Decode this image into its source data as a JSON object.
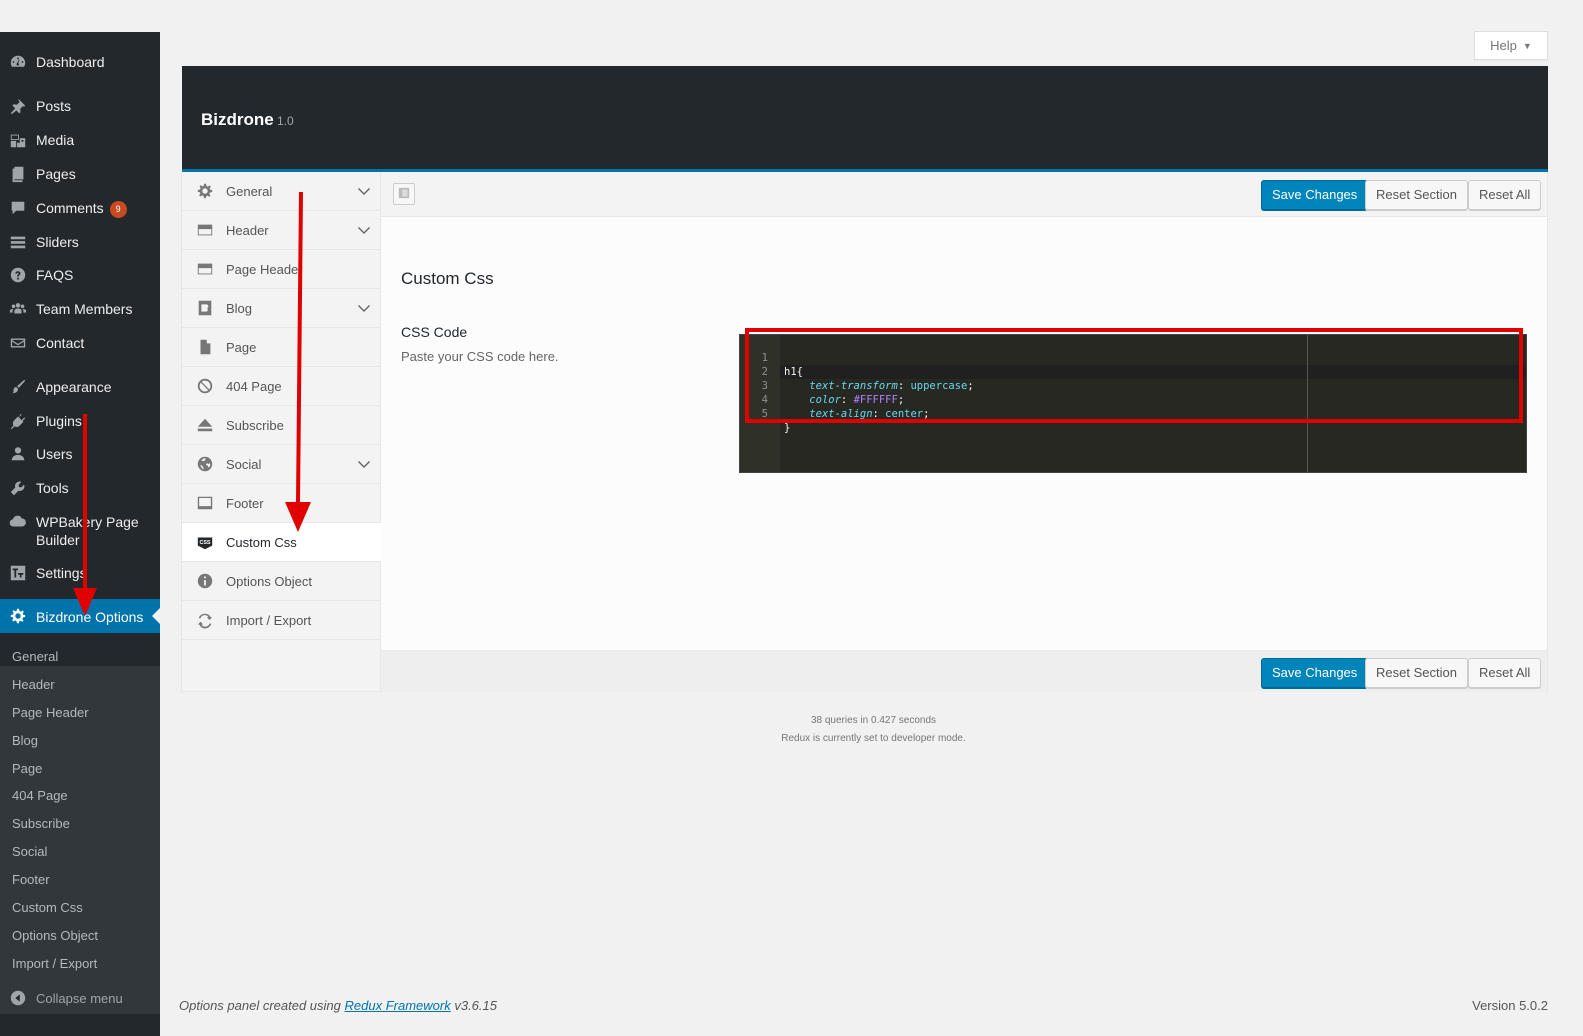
{
  "admin_menu": {
    "items": [
      {
        "label": "Dashboard",
        "icon": "dashboard-icon"
      },
      {
        "label": "Posts",
        "icon": "pushpin-icon"
      },
      {
        "label": "Media",
        "icon": "media-icon"
      },
      {
        "label": "Pages",
        "icon": "pages-icon"
      },
      {
        "label": "Comments",
        "icon": "comment-icon",
        "badge": "9"
      },
      {
        "label": "Sliders",
        "icon": "sliders-icon"
      },
      {
        "label": "FAQS",
        "icon": "question-icon"
      },
      {
        "label": "Team Members",
        "icon": "groups-icon"
      },
      {
        "label": "Contact",
        "icon": "email-icon"
      },
      {
        "label": "Appearance",
        "icon": "paintbrush-icon"
      },
      {
        "label": "Plugins",
        "icon": "plugin-icon"
      },
      {
        "label": "Users",
        "icon": "user-icon"
      },
      {
        "label": "Tools",
        "icon": "wrench-icon"
      },
      {
        "label": "WPBakery Page Builder",
        "icon": "cloud-icon"
      },
      {
        "label": "Settings",
        "icon": "settings-icon"
      },
      {
        "label": "Bizdrone Options",
        "icon": "gear-icon",
        "current": true
      }
    ],
    "submenu": [
      "General",
      "Header",
      "Page Header",
      "Blog",
      "Page",
      "404 Page",
      "Subscribe",
      "Social",
      "Footer",
      "Custom Css",
      "Options Object",
      "Import / Export"
    ],
    "collapse_label": "Collapse menu"
  },
  "help_tab": {
    "label": "Help"
  },
  "redux": {
    "title": "Bizdrone",
    "version": "1.0",
    "sections": [
      {
        "label": "General",
        "icon": "gear-icon",
        "has_children": true
      },
      {
        "label": "Header",
        "icon": "header-icon",
        "has_children": true
      },
      {
        "label": "Page Header",
        "icon": "header-icon",
        "has_children": false
      },
      {
        "label": "Blog",
        "icon": "blog-icon",
        "has_children": true
      },
      {
        "label": "Page",
        "icon": "page-icon",
        "has_children": false
      },
      {
        "label": "404 Page",
        "icon": "forbidden-icon",
        "has_children": false
      },
      {
        "label": "Subscribe",
        "icon": "eject-icon",
        "has_children": false
      },
      {
        "label": "Social",
        "icon": "globe-icon",
        "has_children": true
      },
      {
        "label": "Footer",
        "icon": "footer-icon",
        "has_children": false
      },
      {
        "label": "Custom Css",
        "icon": "css-icon",
        "has_children": false,
        "active": true
      },
      {
        "label": "Options Object",
        "icon": "info-icon",
        "has_children": false
      },
      {
        "label": "Import / Export",
        "icon": "refresh-icon",
        "has_children": false
      }
    ],
    "buttons": {
      "save": "Save Changes",
      "reset_section": "Reset Section",
      "reset_all": "Reset All"
    },
    "section_title": "Custom Css",
    "field": {
      "title": "CSS Code",
      "description": "Paste your CSS code here.",
      "code_lines": [
        "h1{",
        "    text-transform: uppercase;",
        "    color: #FFFFFF;",
        "    text-align: center;",
        "}"
      ]
    },
    "stats": "38 queries in 0.427 seconds",
    "dev_mode": "Redux is currently set to developer mode."
  },
  "footer": {
    "left_prefix": "Options panel created using",
    "left_link": "Redux Framework",
    "left_suffix": "v3.6.15",
    "version": "Version 5.0.2"
  },
  "colors": {
    "admin_bg": "#23282d",
    "accent": "#0073aa",
    "primary_button": "#0085ba",
    "annotation": "#e00000",
    "editor_bg": "#272822"
  }
}
